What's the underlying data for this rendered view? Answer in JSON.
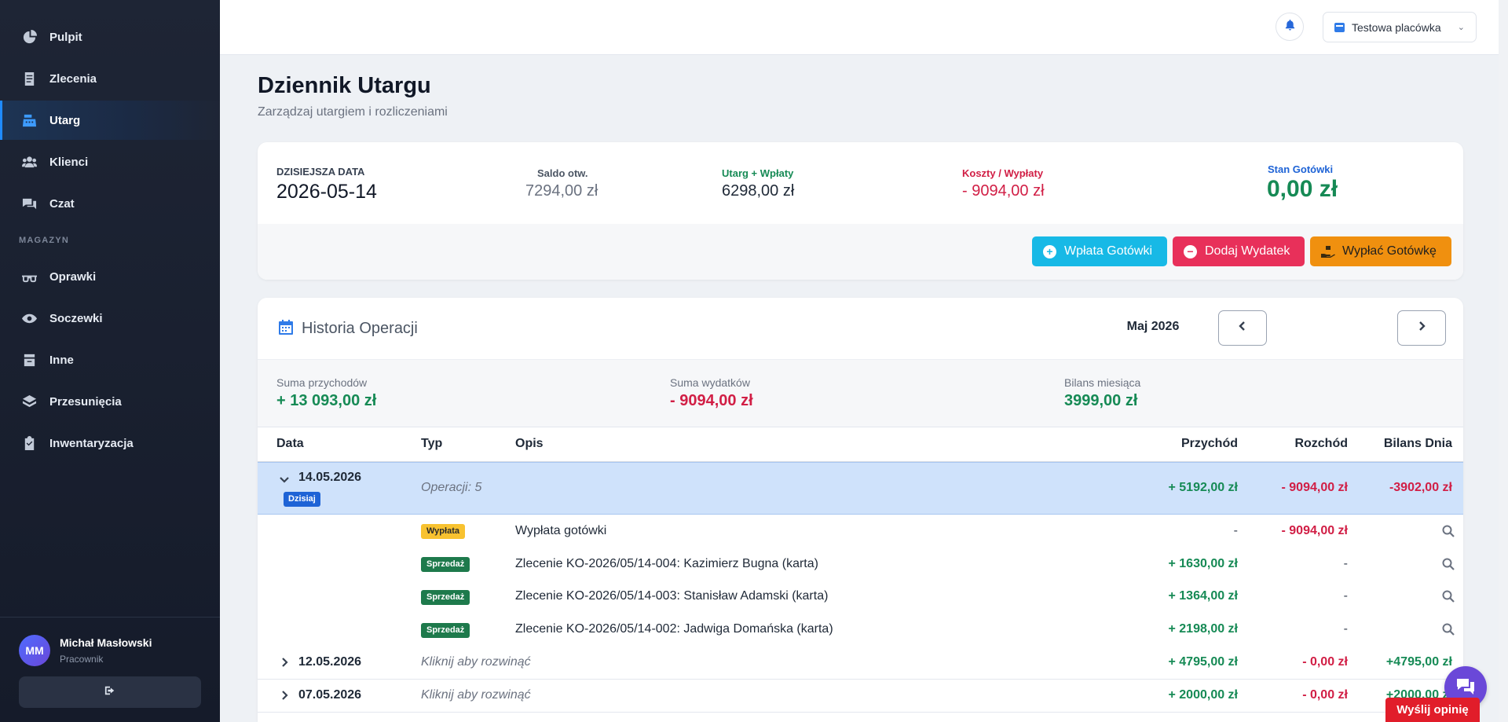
{
  "sidebar": {
    "items": [
      {
        "label": "Pulpit",
        "icon": "dashboard-icon"
      },
      {
        "label": "Zlecenia",
        "icon": "orders-icon"
      },
      {
        "label": "Utarg",
        "icon": "cash-register-icon",
        "active": true
      },
      {
        "label": "Klienci",
        "icon": "users-icon"
      },
      {
        "label": "Czat",
        "icon": "chat-icon"
      }
    ],
    "section_label": "MAGAZYN",
    "warehouse_items": [
      {
        "label": "Oprawki",
        "icon": "glasses-icon"
      },
      {
        "label": "Soczewki",
        "icon": "eye-icon"
      },
      {
        "label": "Inne",
        "icon": "box-icon"
      },
      {
        "label": "Przesunięcia",
        "icon": "transfer-icon"
      },
      {
        "label": "Inwentaryzacja",
        "icon": "clipboard-icon"
      }
    ],
    "user": {
      "initials": "MM",
      "name": "Michał Masłowski",
      "role": "Pracownik"
    }
  },
  "topbar": {
    "branch": "Testowa placówka"
  },
  "page": {
    "title": "Dziennik Utargu",
    "subtitle": "Zarządzaj utargiem i rozliczeniami"
  },
  "summary": {
    "date_label": "DZISIEJSZA DATA",
    "date_value": "2026-05-14",
    "opening_label": "Saldo otw.",
    "opening_value": "7294,00 zł",
    "income_label": "Utarg + Wpłaty",
    "income_value": "6298,00 zł",
    "costs_label": "Koszty / Wypłaty",
    "costs_value": "- 9094,00 zł",
    "cash_label": "Stan Gotówki",
    "cash_value": "0,00 zł",
    "buttons": {
      "deposit": "Wpłata Gotówki",
      "expense": "Dodaj Wydatek",
      "withdraw": "Wypłać Gotówkę"
    }
  },
  "history": {
    "title": "Historia Operacji",
    "month": "Maj 2026",
    "totals": {
      "income_label": "Suma przychodów",
      "income_value": "+ 13 093,00 zł",
      "expense_label": "Suma wydatków",
      "expense_value": "- 9094,00 zł",
      "balance_label": "Bilans miesiąca",
      "balance_value": "3999,00 zł"
    },
    "columns": {
      "date": "Data",
      "type": "Typ",
      "desc": "Opis",
      "income": "Przychód",
      "expense": "Rozchód",
      "balance": "Bilans Dnia"
    },
    "open_day": {
      "date": "14.05.2026",
      "badge": "Dzisiaj",
      "ops": "Operacji: 5",
      "income": "+ 5192,00 zł",
      "expense": "- 9094,00 zł",
      "balance": "-3902,00 zł",
      "operations": [
        {
          "type": "Wypłata",
          "desc": "Wypłata gotówki",
          "income": "-",
          "expense": "- 9094,00 zł"
        },
        {
          "type": "Sprzedaż",
          "desc": "Zlecenie KO-2026/05/14-004: Kazimierz Bugna (karta)",
          "income": "+ 1630,00 zł",
          "expense": "-"
        },
        {
          "type": "Sprzedaż",
          "desc": "Zlecenie KO-2026/05/14-003: Stanisław Adamski (karta)",
          "income": "+ 1364,00 zł",
          "expense": "-"
        },
        {
          "type": "Sprzedaż",
          "desc": "Zlecenie KO-2026/05/14-002: Jadwiga Domańska (karta)",
          "income": "+ 2198,00 zł",
          "expense": "-"
        }
      ]
    },
    "closed_days": [
      {
        "date": "12.05.2026",
        "hint": "Kliknij aby rozwinąć",
        "income": "+ 4795,00 zł",
        "expense": "- 0,00 zł",
        "balance": "+4795,00 zł"
      },
      {
        "date": "07.05.2026",
        "hint": "Kliknij aby rozwinąć",
        "income": "+ 2000,00 zł",
        "expense": "- 0,00 zł",
        "balance": "+2000,00 zł"
      }
    ]
  },
  "feedback": "Wyślij opinię",
  "colors": {
    "accent": "#1f8bff",
    "income": "#168a55",
    "expense": "#d11e45",
    "deposit_btn": "#17b9e6",
    "expense_btn": "#e8305a",
    "withdraw_btn": "#f0900f"
  }
}
